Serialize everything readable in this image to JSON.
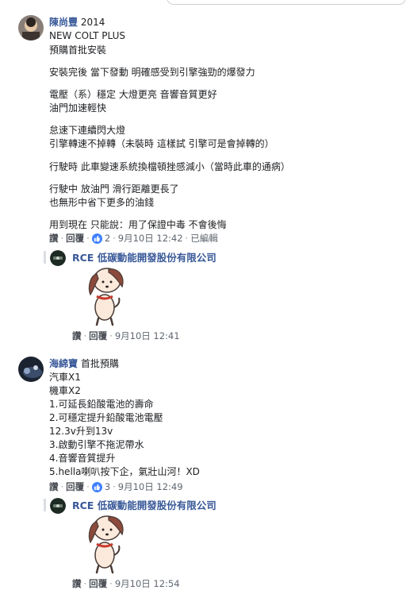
{
  "colors": {
    "link": "#385898",
    "like": "#4080ff",
    "muted": "#606770"
  },
  "comments": [
    {
      "author": "陳尚豐",
      "author_suffix": "2014",
      "lines": [
        "NEW COLT PLUS",
        "預購首批安裝",
        "安裝完後 當下發動 明確感受到引擎強勁的爆發力",
        "電壓（系）穩定 大燈更亮 音響音質更好",
        "油門加速輕快",
        "怠速下連續閃大燈",
        "引擎轉速不掉轉（未裝時 這樣試 引擎可是會掉轉的）",
        "行駛時 此車變速系統換檔頓挫感減小（當時此車的通病）",
        "行駛中 放油門 滑行距離更長了",
        "也無形中省下更多的油錢",
        "用到現在 只能說：用了保證中毒 不會後悔"
      ],
      "actions": {
        "like": "讚",
        "reply": "回覆",
        "reactions": "2",
        "time": "9月10日 12:42",
        "edited": "已編輯"
      },
      "reply": {
        "author": "RCE 低碳動能開發股份有限公司",
        "actions": {
          "like": "讚",
          "reply": "回覆",
          "time": "9月10日 12:41"
        }
      }
    },
    {
      "author": "海綿寶",
      "author_suffix": "首批預購",
      "lines": [
        "汽車X1",
        "機車X2",
        "1.可延長鉛酸電池的壽命",
        "2.可穩定提升鉛酸電池電壓",
        "12.3v升到13v",
        "3.啟動引擎不拖泥帶水",
        "4.音響音質提升",
        "5.hella喇叭按下企，氣壯山河！XD"
      ],
      "actions": {
        "like": "讚",
        "reply": "回覆",
        "reactions": "3",
        "time": "9月10日 12:49"
      },
      "reply": {
        "author": "RCE 低碳動能開發股份有限公司",
        "actions": {
          "like": "讚",
          "reply": "回覆",
          "time": "9月10日 12:54"
        }
      }
    }
  ]
}
